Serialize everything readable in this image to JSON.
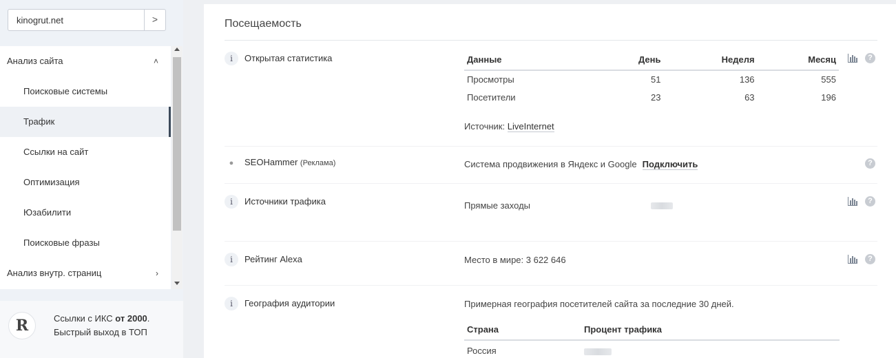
{
  "sidebar": {
    "domain_value": "kinogrut.net",
    "go_label": ">",
    "menu": [
      {
        "label": "Анализ сайта",
        "chevron": "˄"
      },
      {
        "label": "Поисковые системы"
      },
      {
        "label": "Трафик"
      },
      {
        "label": "Ссылки на сайт"
      },
      {
        "label": "Оптимизация"
      },
      {
        "label": "Юзабилити"
      },
      {
        "label": "Поисковые фразы"
      },
      {
        "label": "Анализ внутр. страниц",
        "chevron": "›"
      }
    ],
    "promo": {
      "logo_text": "R",
      "line1_prefix": "Ссылки с ИКС ",
      "line1_bold": "от 2000",
      "line1_suffix": ".",
      "line2": "Быстрый выход в ТОП"
    }
  },
  "main": {
    "section_title": "Посещаемость",
    "info_glyph": "i",
    "dot_glyph": "●",
    "help_glyph": "?",
    "rows": {
      "open_stats": {
        "label": "Открытая статистика",
        "table": {
          "headers": [
            "Данные",
            "День",
            "Неделя",
            "Месяц"
          ],
          "rows": [
            [
              "Просмотры",
              "51",
              "136",
              "555"
            ],
            [
              "Посетители",
              "23",
              "63",
              "196"
            ]
          ]
        },
        "source_prefix": "Источник: ",
        "source_link": "LiveInternet"
      },
      "seohammer": {
        "label": "SEOHammer",
        "label_small": "(Реклама)",
        "text": "Система продвижения в Яндекс и Google",
        "connect": "Подключить"
      },
      "traffic_sources": {
        "label": "Источники трафика",
        "text": "Прямые заходы"
      },
      "alexa": {
        "label": "Рейтинг Alexa",
        "text": "Место в мире: 3 622 646"
      },
      "geo": {
        "label": "География аудитории",
        "text": "Примерная география посетителей сайта за последние 30 дней.",
        "headers": [
          "Страна",
          "Процент трафика"
        ],
        "rows": [
          [
            "Россия"
          ]
        ]
      }
    }
  }
}
